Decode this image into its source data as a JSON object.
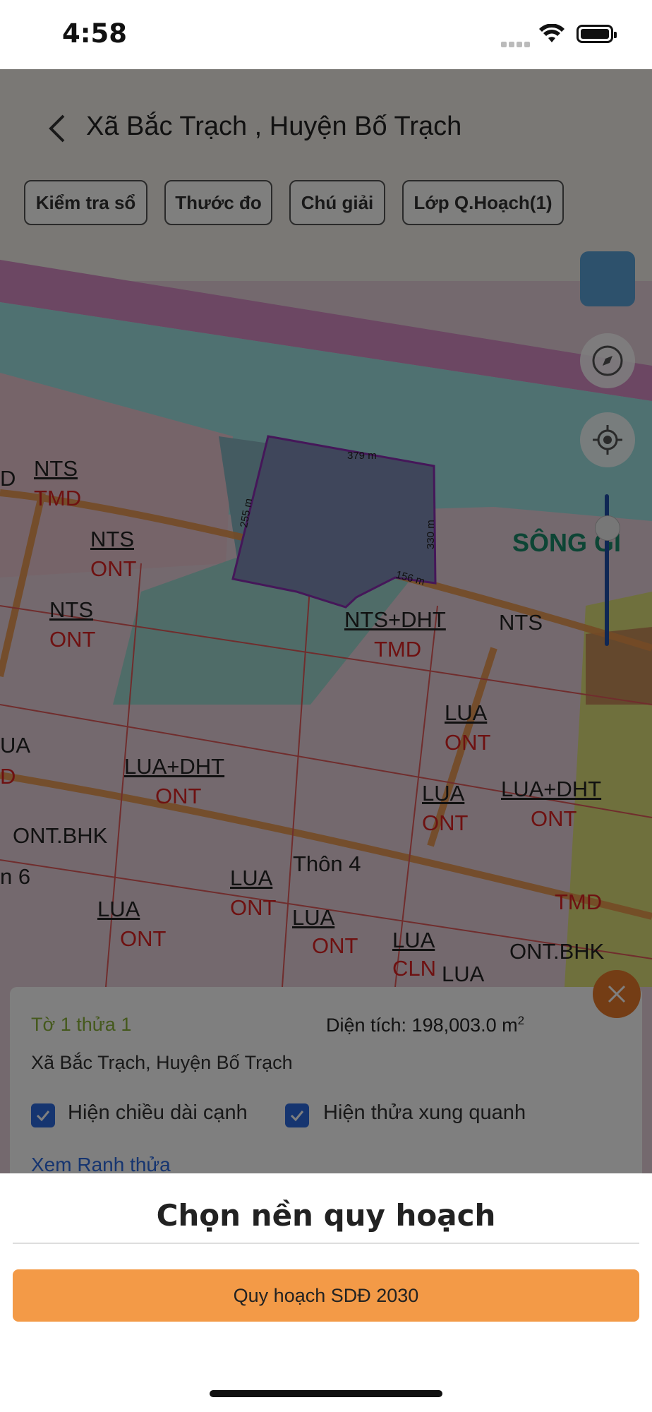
{
  "status_bar": {
    "time": "4:58"
  },
  "header": {
    "title": "Xã Bắc Trạch , Huyện Bố Trạch",
    "chips": [
      "Kiểm tra sổ",
      "Thước đo",
      "Chú giải",
      "Lớp Q.Hoạch(1)"
    ]
  },
  "map": {
    "labels": [
      {
        "t": "NTS"
      },
      {
        "t": "TMD"
      },
      {
        "t": "NTS"
      },
      {
        "t": "ONT"
      },
      {
        "t": "NTS"
      },
      {
        "t": "ONT"
      },
      {
        "t": "NTS+DHT"
      },
      {
        "t": "TMD"
      },
      {
        "t": "NTS"
      },
      {
        "t": "LUA"
      },
      {
        "t": "ONT"
      },
      {
        "t": "LUA+DHT"
      },
      {
        "t": "ONT"
      },
      {
        "t": "LUA"
      },
      {
        "t": "ONT"
      },
      {
        "t": "LUA+DHT"
      },
      {
        "t": "ONT"
      },
      {
        "t": "ONT.BHK"
      },
      {
        "t": "Thôn 4"
      },
      {
        "t": "LUA"
      },
      {
        "t": "ONT"
      },
      {
        "t": "LUA"
      },
      {
        "t": "ONT"
      },
      {
        "t": "LUA"
      },
      {
        "t": "ONT"
      },
      {
        "t": "LUA"
      },
      {
        "t": "CLN"
      },
      {
        "t": "LUA"
      },
      {
        "t": "ONT.BHK"
      },
      {
        "t": "TMD"
      },
      {
        "t": "SÔNG GI"
      },
      {
        "t": "UA"
      },
      {
        "t": "D"
      },
      {
        "t": "D"
      },
      {
        "t": "n 6"
      }
    ],
    "dimensions": [
      "379 m",
      "255 m",
      "330 m",
      "156 m"
    ]
  },
  "info_panel": {
    "parcel": "Tờ 1 thửa 1",
    "area_label": "Diện tích: 198,003.0 m",
    "area_unit_sup": "2",
    "address": "Xã Bắc Trạch, Huyện Bố Trạch",
    "checkbox_edges": "Hiện chiều dài cạnh",
    "checkbox_neighbors": "Hiện thửa xung quanh",
    "link": "Xem Ranh thửa"
  },
  "sheet": {
    "title": "Chọn nền quy hoạch",
    "option": "Quy hoạch SDĐ 2030"
  },
  "colors": {
    "accent": "#f39a47",
    "link": "#2d6be0",
    "close": "#e87a2a"
  }
}
